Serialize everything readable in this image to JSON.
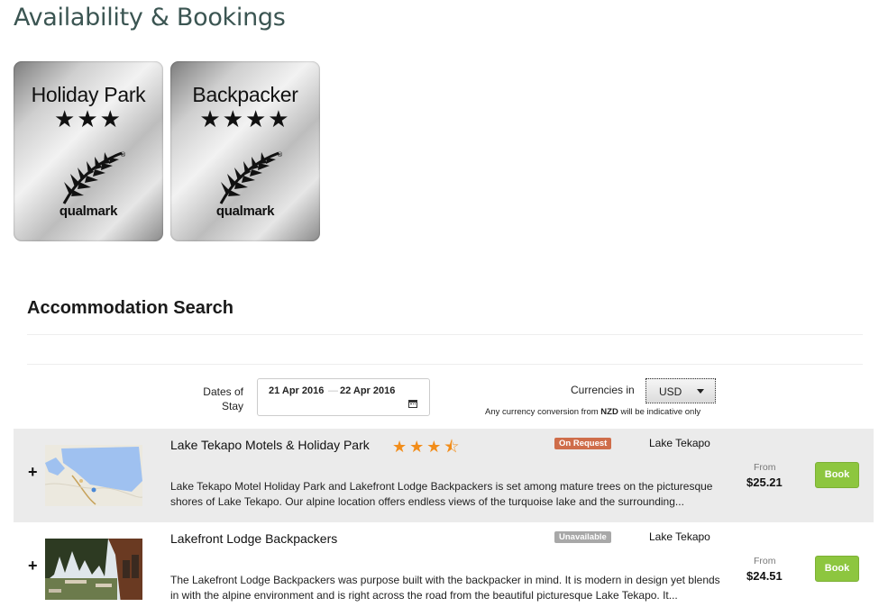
{
  "page": {
    "title": "Availability & Bookings"
  },
  "badges": [
    {
      "title": "Holiday Park",
      "stars": "★★★",
      "brand": "qualmark"
    },
    {
      "title": "Backpacker",
      "stars": "★★★★",
      "brand": "qualmark"
    }
  ],
  "search": {
    "title": "Accommodation Search",
    "dates_label_line1": "Dates of",
    "dates_label_line2": "Stay",
    "date_from": "21 Apr 2016",
    "date_sep": "—",
    "date_to": "22 Apr 2016",
    "currency_label": "Currencies in",
    "currency_value": "USD",
    "currency_note_prefix": "Any currency conversion from ",
    "currency_note_code": "NZD",
    "currency_note_suffix": " will be indicative only"
  },
  "results": [
    {
      "name": "Lake Tekapo Motels & Holiday Park",
      "rating_stars": "★★★⯪",
      "rating_value": 3.5,
      "status": "On Request",
      "location": "Lake Tekapo",
      "description": "Lake Tekapo Motel Holiday Park and Lakefront Lodge Backpackers is set among mature trees on the picturesque shores of Lake Tekapo. Our alpine location offers endless views of the turquoise lake and the surrounding...",
      "from_label": "From",
      "price": "$25.21",
      "book_label": "Book",
      "expand": "+"
    },
    {
      "name": "Lakefront Lodge Backpackers",
      "status": "Unavailable",
      "location": "Lake Tekapo",
      "description": "The Lakefront Lodge Backpackers was purpose built with the backpacker in mind. It is modern in design yet blends in with the alpine environment and is right across the road from the beautiful picturesque Lake Tekapo. It...",
      "from_label": "From",
      "price": "$24.51",
      "book_label": "Book",
      "expand": "+"
    }
  ],
  "colors": {
    "title": "#3b5552",
    "on_request": "#cf6d4a",
    "unavailable": "#a8a8a8",
    "book": "#8dc63f",
    "star": "#f28d1a"
  }
}
